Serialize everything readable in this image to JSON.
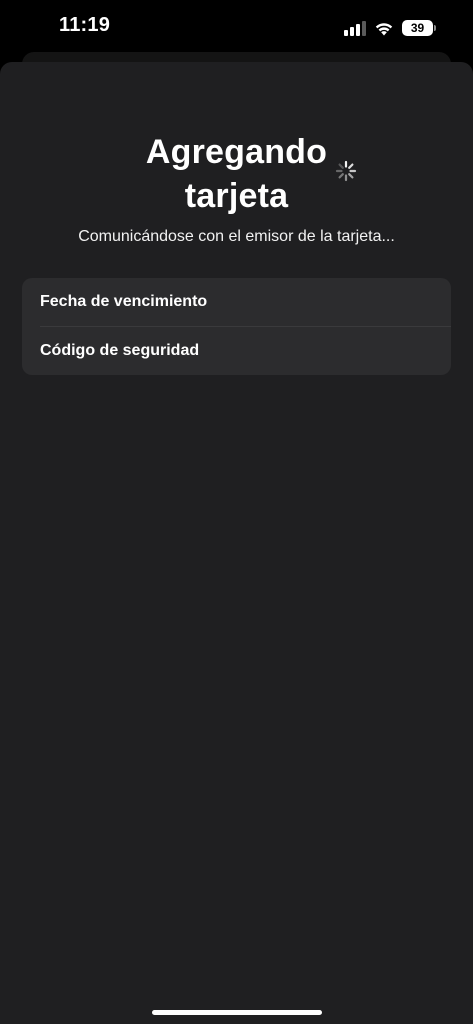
{
  "status_bar": {
    "time": "11:19",
    "battery_percent": "39",
    "icons": [
      "cellular-signal-icon",
      "wifi-icon",
      "battery-icon"
    ]
  },
  "sheet": {
    "title_line1": "Agregando",
    "title_line2": "tarjeta",
    "subtitle": "Comunicándose con el emisor de la tarjeta...",
    "activity_icon": "spinner-icon",
    "fields": [
      {
        "label": "Fecha de vencimiento"
      },
      {
        "label": "Código de seguridad"
      }
    ]
  },
  "colors": {
    "background": "#000000",
    "sheet": "#1f1f21",
    "group": "#2c2c2e",
    "text": "#ffffff"
  }
}
